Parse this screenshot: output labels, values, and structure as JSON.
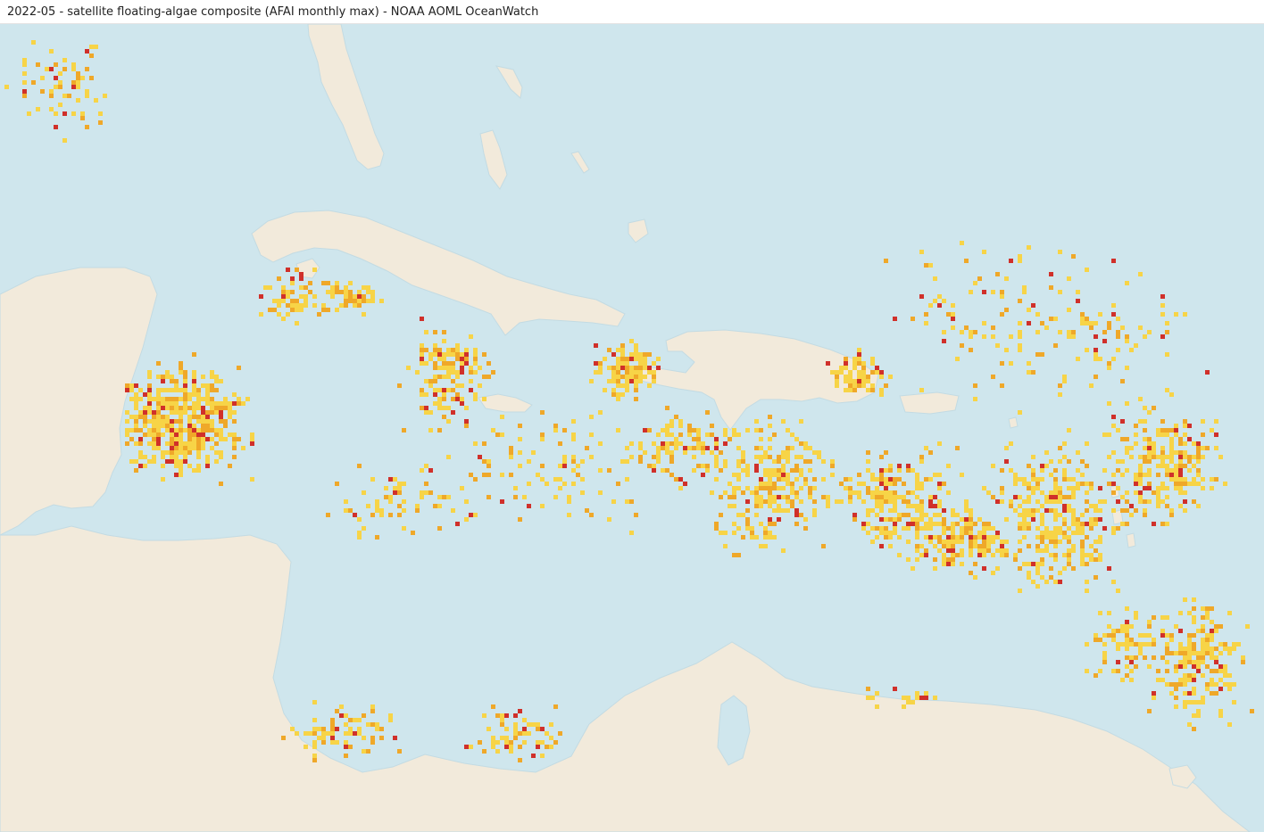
{
  "title": "2022-05 - satellite floating-algae composite (AFAI monthly max) - NOAA AOML OceanWatch",
  "colors": {
    "ocean": "#cfe6ed",
    "land": "#f2eadb",
    "coast": "#c3dbe3",
    "algae_low": "#f7d447",
    "algae_mid": "#efa829",
    "algae_high": "#d0302a"
  },
  "map": {
    "layer_type": "pixel-heatmap",
    "variable": "AFAI monthly max",
    "cell_classes": [
      "low",
      "mid",
      "high"
    ]
  }
}
